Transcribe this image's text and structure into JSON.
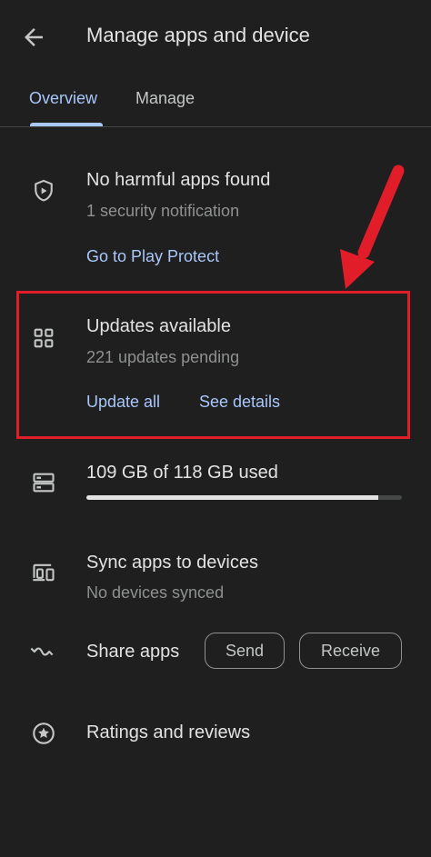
{
  "header": {
    "title": "Manage apps and device"
  },
  "tabs": [
    {
      "label": "Overview"
    },
    {
      "label": "Manage"
    }
  ],
  "protect": {
    "title": "No harmful apps found",
    "subtitle": "1 security notification",
    "link": "Go to Play Protect"
  },
  "updates": {
    "title": "Updates available",
    "subtitle": "221 updates pending",
    "update_all": "Update all",
    "see_details": "See details"
  },
  "storage": {
    "label": "109 GB of 118 GB used",
    "used_fraction": 0.924
  },
  "sync": {
    "title": "Sync apps to devices",
    "subtitle": "No devices synced"
  },
  "share": {
    "title": "Share apps",
    "send": "Send",
    "receive": "Receive"
  },
  "ratings": {
    "title": "Ratings and reviews"
  },
  "colors": {
    "accent": "#a8c7fa",
    "highlight": "#e11d2a",
    "background": "#1f1f1f"
  }
}
